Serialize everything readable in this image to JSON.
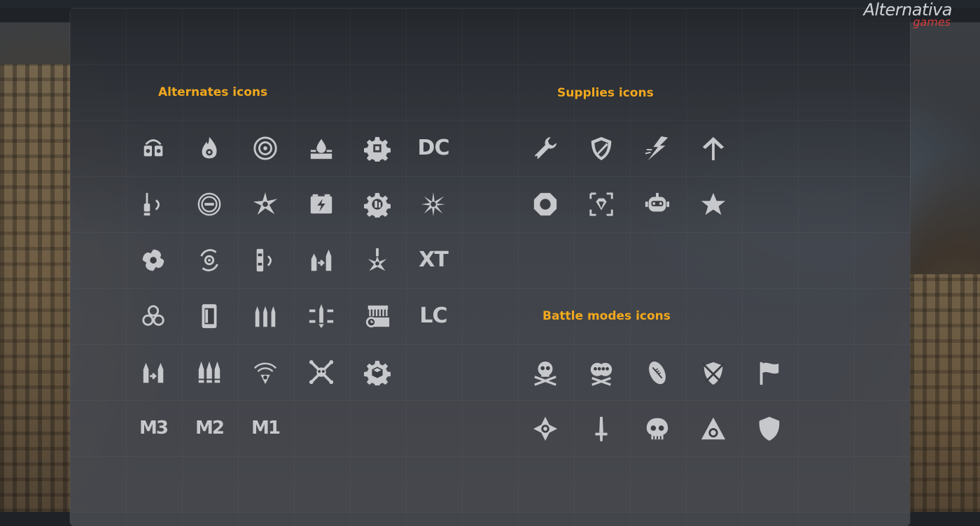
{
  "brand": {
    "name": "Alternativa",
    "sub": "games"
  },
  "colors": {
    "accent": "#f2a81d",
    "icon": "#c6c8cb",
    "brand_red": "#d43b3b"
  },
  "sections": {
    "alternates": {
      "title": "Alternates icons",
      "rows": [
        [
          "fuel-tanks-icon",
          "flame-core-icon",
          "turbine-ring-icon",
          "water-puddle-icon",
          "gear-chip-icon",
          "DC"
        ],
        [
          "dropper-reload-icon",
          "concentric-rings-icon",
          "vortex-star-icon",
          "battery-charge-icon",
          "gear-brain-icon",
          "starburst-icon"
        ],
        [
          "spiral-vortex-icon",
          "cycle-orb-icon",
          "canister-reload-icon",
          "shell-transfer-icon",
          "laser-burst-icon",
          "XT"
        ],
        [
          "triskelion-icon",
          "magazine-card-icon",
          "triple-shells-icon",
          "missile-spread-icon",
          "timed-charge-icon",
          "LC"
        ],
        [
          "ammo-transfer-icon",
          "triple-ammo-icon",
          "wireless-drone-icon",
          "crossbones-x-icon",
          "gear-cube-icon"
        ],
        [
          "M3",
          "M2",
          "M1"
        ]
      ]
    },
    "supplies": {
      "title": "Supplies icons",
      "rows": [
        [
          "wrench-icon",
          "shield-slash-icon",
          "lightning-strike-icon",
          "up-arrow-icon"
        ],
        [
          "octagon-ring-icon",
          "diamond-frame-icon",
          "robot-head-icon",
          "star-icon"
        ]
      ]
    },
    "battle_modes": {
      "title": "Battle modes icons",
      "rows": [
        [
          "skull-crossbones-icon",
          "double-skull-icon",
          "rugby-ball-icon",
          "shield-swords-icon",
          "flag-icon"
        ],
        [
          "compass-diamond-icon",
          "sword-icon",
          "skull-icon",
          "triangle-ring-icon",
          "plain-shield-icon"
        ]
      ]
    }
  }
}
